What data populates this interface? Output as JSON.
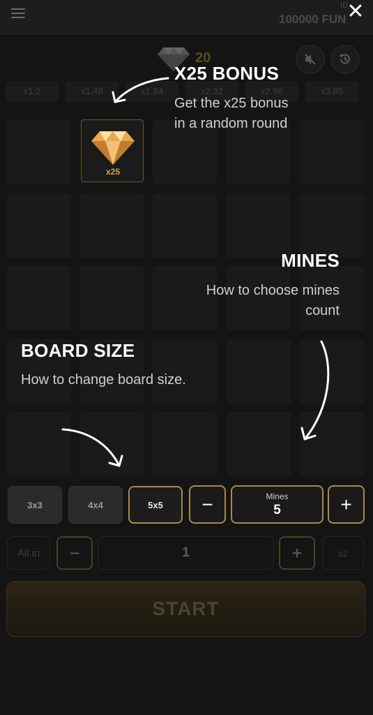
{
  "header": {
    "balance": "100000 FUN",
    "id_label": "ID"
  },
  "top": {
    "diamond_count": "20",
    "icons": [
      "menu-icon",
      "close-icon",
      "diamond-icon",
      "sound-off-icon",
      "history-icon"
    ]
  },
  "multipliers": [
    "x1.2",
    "x1.48",
    "x1.84",
    "x2.32",
    "x2.96",
    "x3.85"
  ],
  "bonus_cell": {
    "label": "x25"
  },
  "tips": {
    "bonus": {
      "title": "X25 BONUS",
      "line1": "Get the x25 bonus",
      "line2": "in a random round"
    },
    "mines": {
      "title": "MINES",
      "line1": "How to choose mines",
      "line2": "count"
    },
    "board": {
      "title": "BOARD SIZE",
      "line1": "How to change board size."
    }
  },
  "controls": {
    "sizes": [
      "3x3",
      "4x4",
      "5x5"
    ],
    "active_size": "5x5",
    "mines_label": "Mines",
    "mines_value": "5",
    "minus": "−",
    "plus": "+",
    "all_in": "All in",
    "bet_value": "1",
    "x2": "x2",
    "start": "START"
  },
  "colors": {
    "accent": "#a88a4a",
    "bonus": "#d9a64a",
    "background": "#141414"
  }
}
